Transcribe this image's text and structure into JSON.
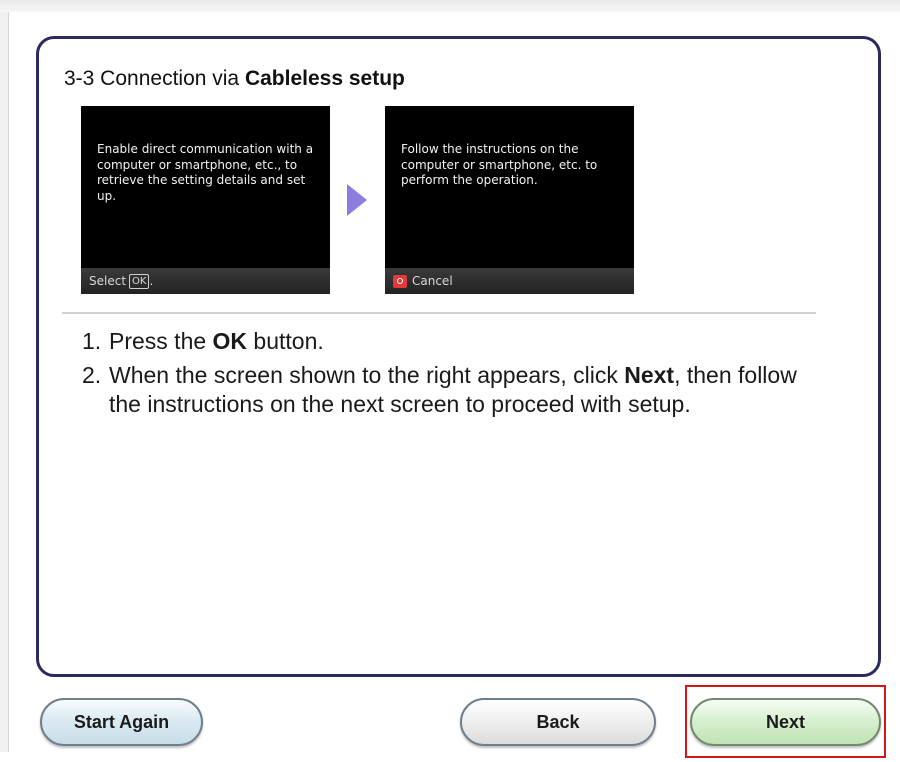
{
  "header": {
    "prefix": "3-3 Connection via ",
    "bold": "Cableless setup"
  },
  "screens": [
    {
      "text": "Enable direct communication with a computer or smartphone, etc., to retrieve the setting details and set up.",
      "footer_label": "Select",
      "footer_key": "OK",
      "footer_suffix": "."
    },
    {
      "text": "Follow the instructions on the computer or smartphone, etc. to perform the operation.",
      "footer_label": "Cancel"
    }
  ],
  "steps": [
    {
      "number": "1.",
      "before": "Press the ",
      "bold": "OK",
      "after": " button."
    },
    {
      "number": "2.",
      "before": "When the screen shown to the right appears, click ",
      "bold": "Next",
      "after": ", then follow the instructions on the next screen to proceed with setup."
    }
  ],
  "buttons": {
    "start_again": "Start Again",
    "back": "Back",
    "next": "Next"
  },
  "colors": {
    "panel_border": "#2a2a5c",
    "arrow": "#8c7ee0",
    "highlight": "#d01818"
  },
  "icons": {
    "arrow": "right-arrow-icon",
    "stop": "stop-icon"
  }
}
